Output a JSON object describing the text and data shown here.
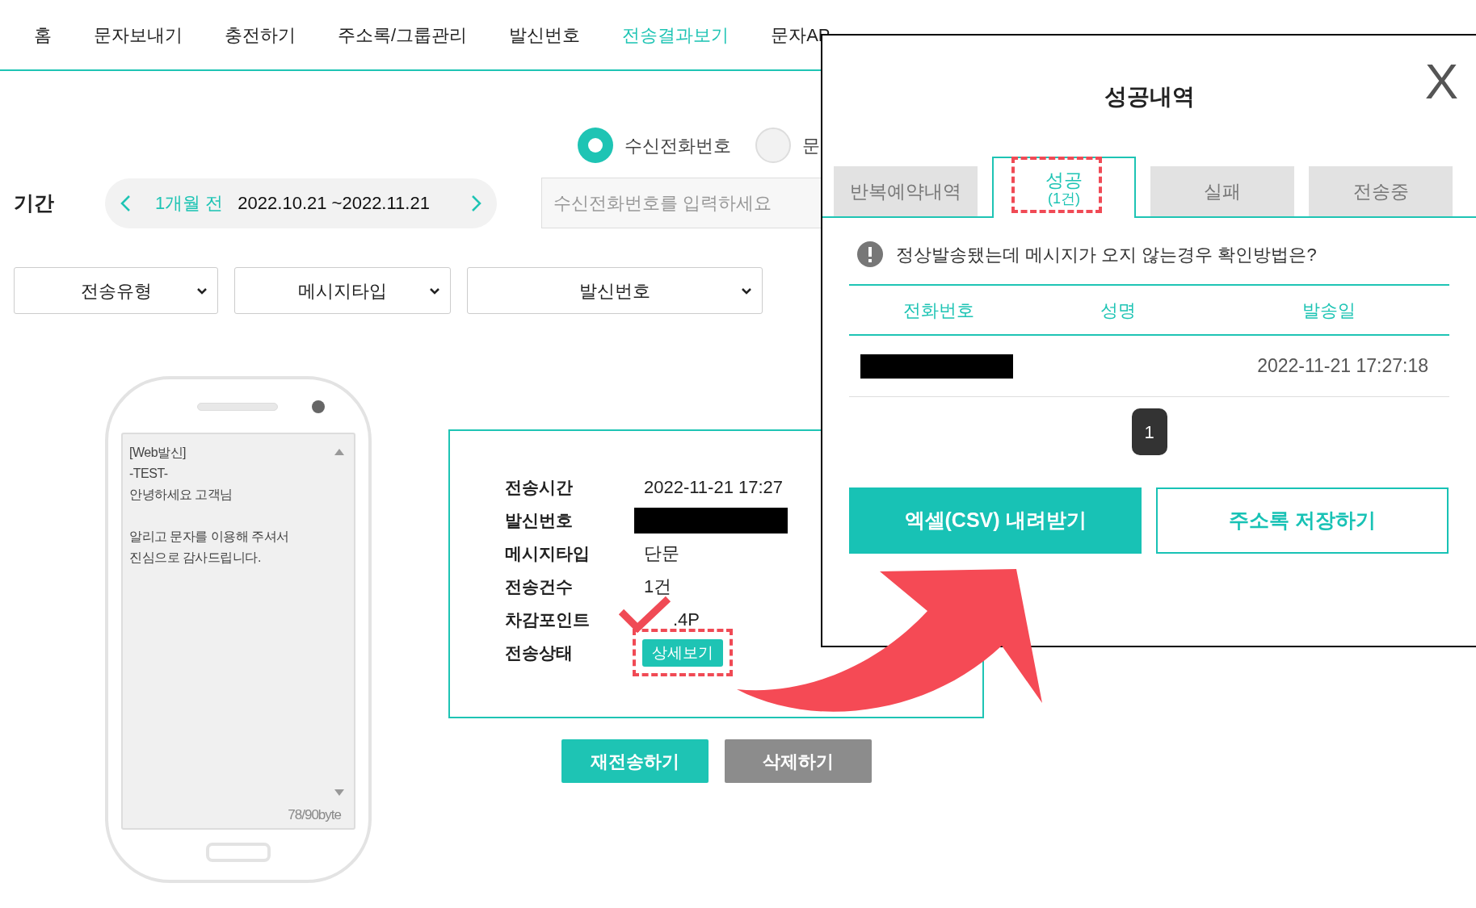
{
  "nav": {
    "items": [
      {
        "label": "홈",
        "selected": false
      },
      {
        "label": "문자보내기",
        "selected": false
      },
      {
        "label": "충전하기",
        "selected": false
      },
      {
        "label": "주소록/그룹관리",
        "selected": false
      },
      {
        "label": "발신번호",
        "selected": false
      },
      {
        "label": "전송결과보기",
        "selected": true
      },
      {
        "label": "문자AP",
        "selected": false
      }
    ]
  },
  "search_mode": {
    "options": [
      {
        "label": "수신전화번호",
        "selected": true
      },
      {
        "label": "문",
        "selected": false
      }
    ]
  },
  "period": {
    "label": "기간",
    "preset": "1개월 전",
    "range": "2022.10.21 ~2022.11.21"
  },
  "search": {
    "placeholder": "수신전화번호를 입력하세요"
  },
  "filters": [
    "전송유형",
    "메시지타입",
    "발신번호"
  ],
  "phone": {
    "message": "[Web발신]\n-TEST-\n안녕하세요 고객님\n\n알리고 문자를 이용해 주셔서\n진심으로 감사드립니다.",
    "byte_count": "78/90byte"
  },
  "details": {
    "rows": [
      {
        "kind": "text",
        "label": "전송시간",
        "value": "2022-11-21 17:27",
        "checkmark": false
      },
      {
        "kind": "redacted",
        "label": "발신번호",
        "checkmark": false
      },
      {
        "kind": "text",
        "label": "메시지타입",
        "value": "단문",
        "checkmark": false
      },
      {
        "kind": "text",
        "label": "전송건수",
        "value": "1건",
        "checkmark": false
      },
      {
        "kind": "text",
        "label": "차감포인트",
        "value": ".4P",
        "checkmark": true
      },
      {
        "kind": "button",
        "label": "전송상태",
        "button": "상세보기",
        "highlighted": true,
        "checkmark": false
      }
    ]
  },
  "actions": [
    {
      "label": "재전송하기",
      "kind": "primary"
    },
    {
      "label": "삭제하기",
      "kind": "secondary"
    }
  ],
  "modal": {
    "title": "성공내역",
    "close": "X",
    "tabs": [
      {
        "label": "반복예약내역",
        "selected": false,
        "highlighted": false
      },
      {
        "label": "성공",
        "count": "(1건)",
        "selected": true,
        "highlighted": true
      },
      {
        "label": "실패",
        "selected": false,
        "highlighted": false
      },
      {
        "label": "전송중",
        "selected": false,
        "highlighted": false
      }
    ],
    "notice": "정상발송됐는데 메시지가 오지 않는경우 확인방법은?",
    "columns": [
      "전화번호",
      "성명",
      "발송일"
    ],
    "rows": [
      {
        "phone_redacted": true,
        "sent_at": "2022-11-21 17:27:18"
      }
    ],
    "pages": [
      {
        "label": "1",
        "selected": true
      }
    ],
    "buttons": [
      {
        "label": "엑셀(CSV) 내려받기",
        "kind": "primary"
      },
      {
        "label": "주소록 저장하기",
        "kind": "outline"
      }
    ]
  }
}
